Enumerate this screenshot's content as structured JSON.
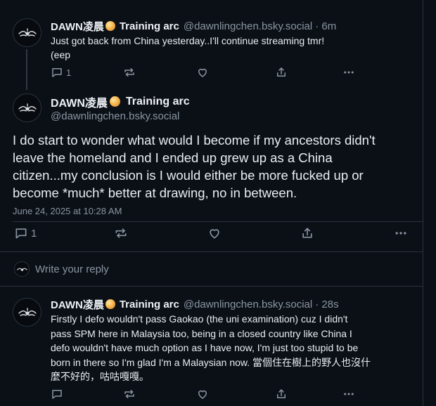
{
  "colors": {
    "background": "#0b1017",
    "text": "#e9edf2",
    "muted": "#8a95a1",
    "divider": "#2a323c",
    "emoji": "#f6b84f"
  },
  "parent_post": {
    "display_name": "DAWN凌晨",
    "name_suffix": "Training arc",
    "handle": "@dawnlingchen.bsky.social",
    "time": "· 6m",
    "text_line1": "Just got back from China yesterday..I'll continue streaming tmr!",
    "text_line2": "(eep",
    "reply_count": "1",
    "icons": [
      "reply-icon",
      "repost-icon",
      "like-icon",
      "share-icon",
      "more-icon"
    ]
  },
  "focus_post": {
    "display_name": "DAWN凌晨",
    "name_suffix": "Training arc",
    "handle": "@dawnlingchen.bsky.social",
    "text_line1": "I do start to wonder what would I become if my ancestors didn't",
    "text_line2": "leave the homeland and I ended up grew up as a China",
    "text_line3": "citizen...my conclusion is I would either be more fucked up or",
    "text_line4": "become *much* better at drawing, no in between.",
    "timestamp": "June 24, 2025 at 10:28 AM",
    "reply_count": "1"
  },
  "composer": {
    "placeholder": "Write your reply"
  },
  "reply_post": {
    "display_name": "DAWN凌晨",
    "name_suffix": "Training arc",
    "handle": "@dawnlingchen.bsky.social",
    "time": "· 28s",
    "text_line1": "Firstly I defo wouldn't pass Gaokao (the uni examination) cuz I didn't",
    "text_line2": "pass SPM here in Malaysia too, being in a closed country like China I",
    "text_line3": "defo wouldn't have much option as I have now, I'm just too stupid to be",
    "text_line4": "born in there so I'm glad I'm a Malaysian now. 當個住在樹上的野人也沒什",
    "text_line5": "麼不好的，咕咕嘎嘎。"
  }
}
